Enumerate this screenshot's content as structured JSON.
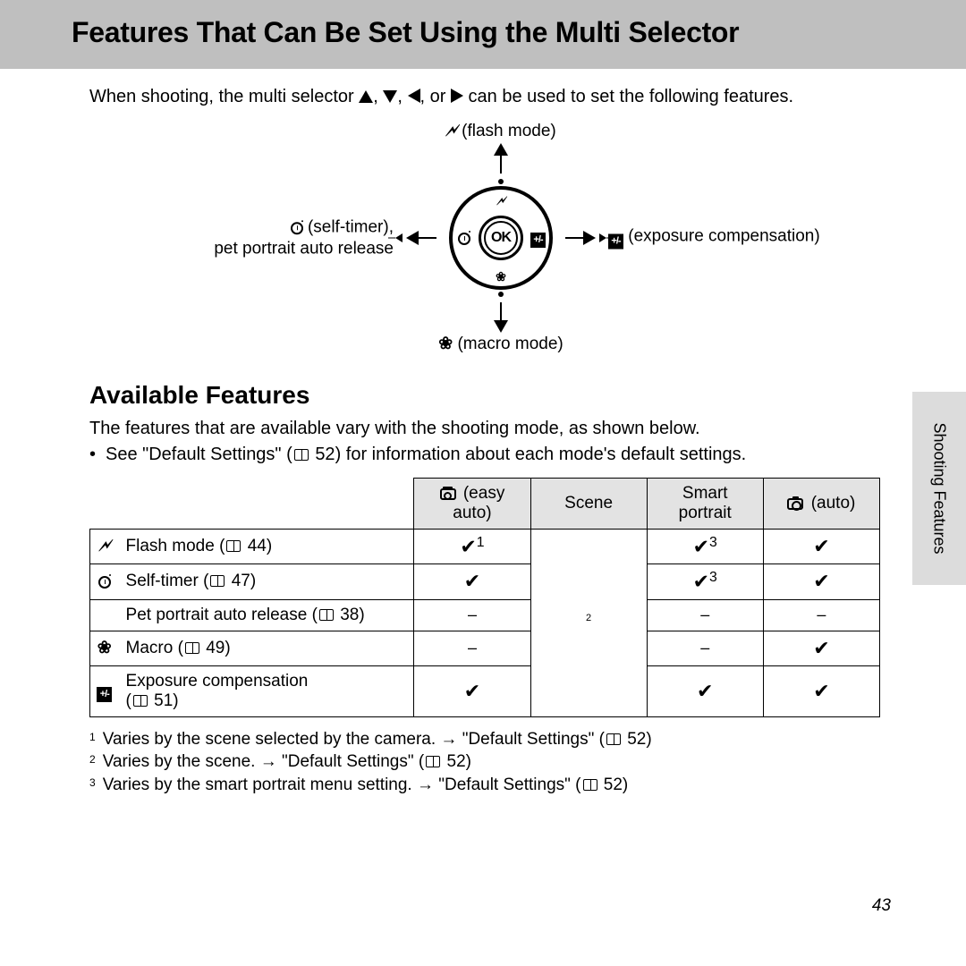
{
  "header": {
    "title": "Features That Can Be Set Using the Multi Selector"
  },
  "intro": {
    "pre": "When shooting, the multi selector ",
    "post": " can be used to set the following features."
  },
  "diagram": {
    "top": {
      "icon": "flash",
      "label": "(flash mode)"
    },
    "bottom": {
      "icon": "macro",
      "label": "(macro mode)"
    },
    "left": {
      "icon": "self-timer",
      "line1": "(self-timer),",
      "line2": "pet portrait auto release"
    },
    "right": {
      "icon": "exposure-comp",
      "label": "(exposure compensation)"
    },
    "center": "OK"
  },
  "available": {
    "heading": "Available Features",
    "p1": "The features that are available vary with the shooting mode, as shown below.",
    "bullet": "See \"Default Settings\" (",
    "bullet_page": "52",
    "bullet_after": ") for information about each mode's default settings."
  },
  "table": {
    "columns": [
      {
        "icon": "easy-auto-camera",
        "label": "(easy auto)"
      },
      {
        "label": "Scene"
      },
      {
        "label": "Smart portrait"
      },
      {
        "icon": "camera",
        "label": "(auto)"
      }
    ],
    "rows": [
      {
        "icon": "flash",
        "name": "Flash mode",
        "page": "44",
        "cells": [
          "check-1",
          "span-2",
          "check-3",
          "check"
        ]
      },
      {
        "icon": "self-timer",
        "name": "Self-timer",
        "page": "47",
        "cells": [
          "check",
          "",
          "check-3",
          "check"
        ]
      },
      {
        "icon": "",
        "name": "Pet portrait auto release",
        "page": "38",
        "cells": [
          "dash",
          "",
          "dash",
          "dash"
        ]
      },
      {
        "icon": "macro",
        "name": "Macro",
        "page": "49",
        "cells": [
          "dash",
          "",
          "dash",
          "check"
        ]
      },
      {
        "icon": "exposure",
        "name": "Exposure compensation",
        "page": "51",
        "cells": [
          "check",
          "",
          "check",
          "check"
        ]
      }
    ]
  },
  "footnotes": {
    "n1": {
      "num": "1",
      "text_a": "Varies by the scene selected by the camera. → \"Default Settings\" (",
      "page": "52",
      "text_b": ")"
    },
    "n2": {
      "num": "2",
      "text_a": "Varies by the scene. → \"Default Settings\" (",
      "page": "52",
      "text_b": ")"
    },
    "n3": {
      "num": "3",
      "text_a": "Varies by the smart portrait menu setting. → \"Default Settings\" (",
      "page": "52",
      "text_b": ")"
    }
  },
  "side_tab": "Shooting Features",
  "page_number": "43"
}
